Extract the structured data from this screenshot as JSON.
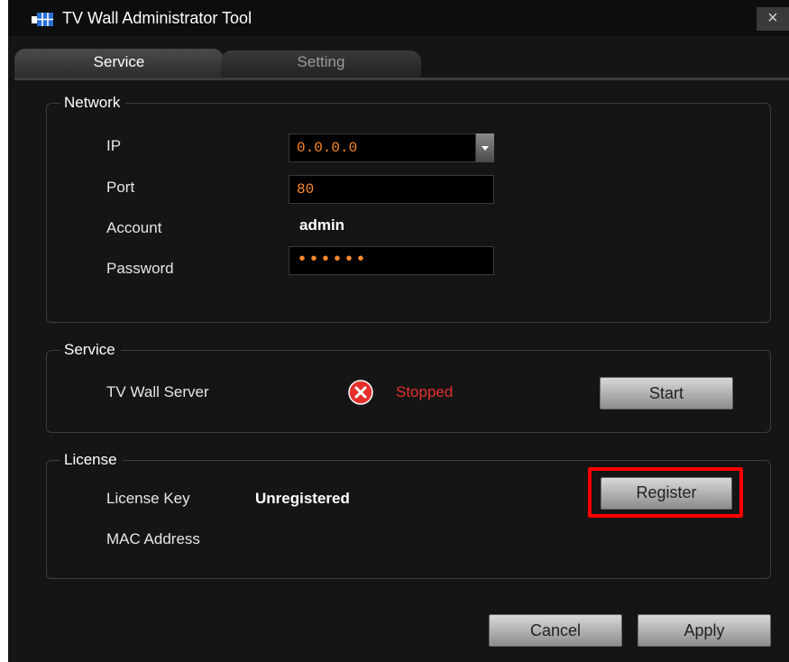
{
  "window": {
    "title": "TV Wall Administrator Tool",
    "close_label": "×"
  },
  "tabs": [
    {
      "label": "Service"
    },
    {
      "label": "Setting"
    }
  ],
  "network": {
    "legend": "Network",
    "ip": {
      "label": "IP",
      "value": "0.0.0.0"
    },
    "port": {
      "label": "Port",
      "value": "80"
    },
    "account": {
      "label": "Account",
      "value": "admin"
    },
    "password": {
      "label": "Password",
      "value": "••••••"
    }
  },
  "service": {
    "legend": "Service",
    "server_label": "TV Wall Server",
    "status_text": "Stopped",
    "status_color": "#e4302c",
    "start_label": "Start"
  },
  "license": {
    "legend": "License",
    "key_label": "License Key",
    "key_value": "Unregistered",
    "mac_label": "MAC Address",
    "register_label": "Register",
    "highlight_color": "#ff0000"
  },
  "footer": {
    "cancel_label": "Cancel",
    "apply_label": "Apply"
  }
}
